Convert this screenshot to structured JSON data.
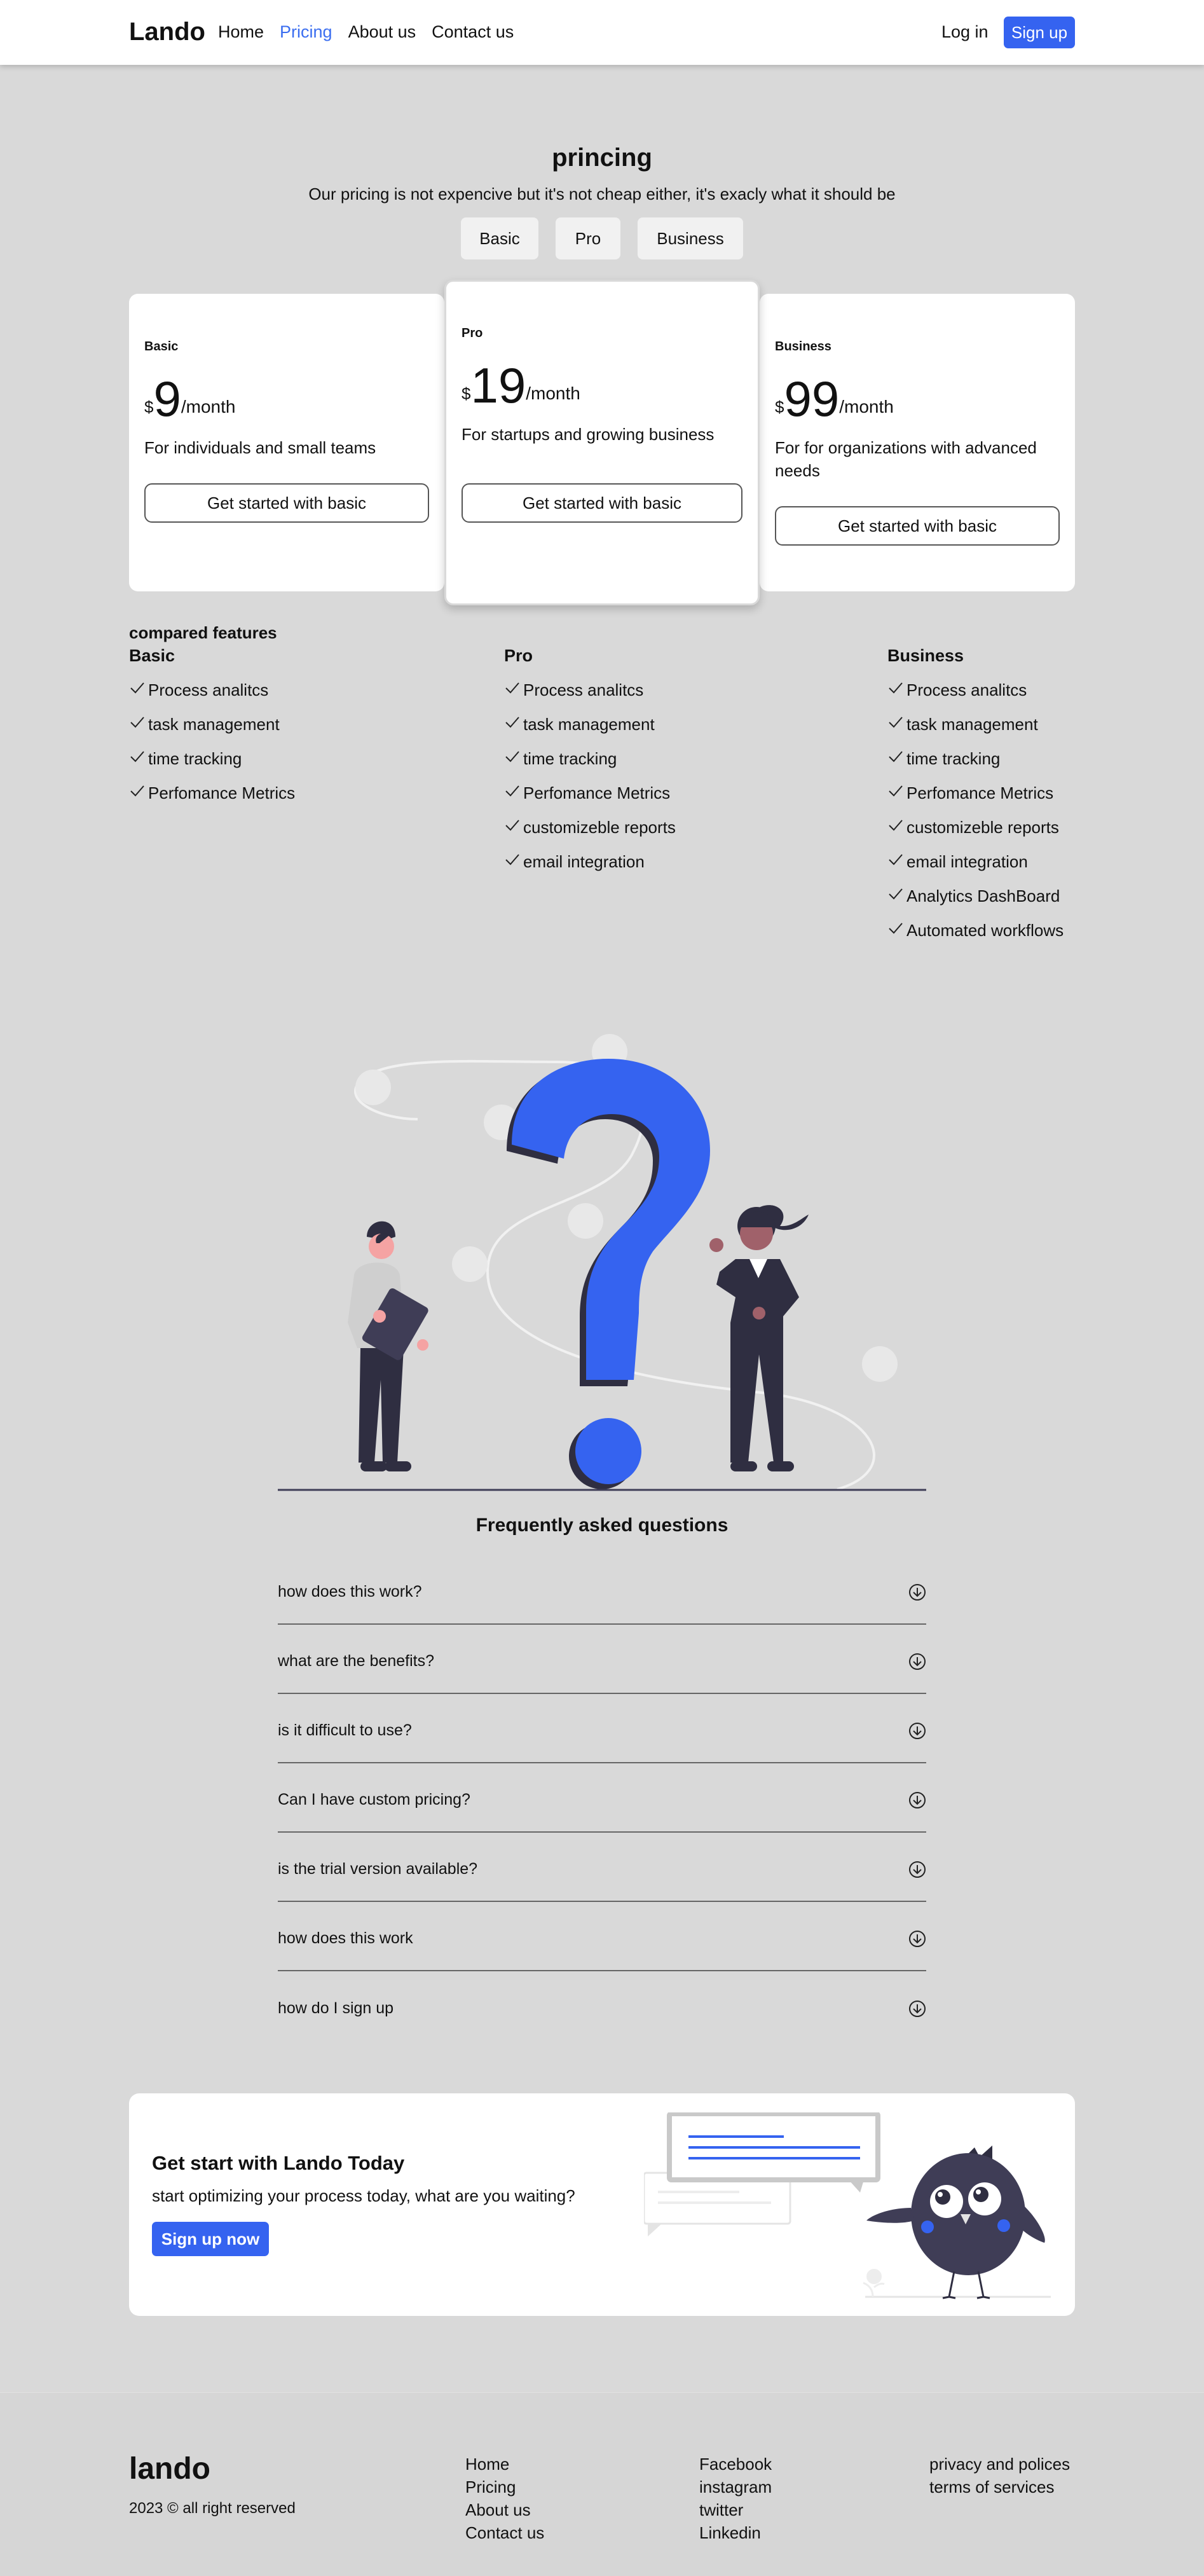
{
  "nav": {
    "logo": "Lando",
    "links": [
      "Home",
      "Pricing",
      "About us",
      "Contact us"
    ],
    "active_link": "Pricing",
    "login": "Log in",
    "signup": "Sign up"
  },
  "pricing": {
    "title": "princing",
    "subtitle": "Our pricing is not expencive but it's not cheap either, it's exacly what it should be",
    "tabs": [
      "Basic",
      "Pro",
      "Business"
    ]
  },
  "cards": [
    {
      "name": "Basic",
      "currency": "$",
      "amount": "9",
      "period": "/month",
      "description": "For individuals and small teams",
      "cta": "Get started with basic"
    },
    {
      "name": "Pro",
      "currency": "$",
      "amount": "19",
      "period": "/month",
      "description": "For startups and growing business",
      "cta": "Get started with basic"
    },
    {
      "name": "Business",
      "currency": "$",
      "amount": "99",
      "period": "/month",
      "description": "For for organizations with advanced needs",
      "cta": "Get started with basic"
    }
  ],
  "features": {
    "title": "compared features",
    "columns": [
      {
        "name": "Basic",
        "items": [
          "Process analitcs",
          "task management",
          "time tracking",
          "Perfomance Metrics"
        ]
      },
      {
        "name": "Pro",
        "items": [
          "Process analitcs",
          "task management",
          "time tracking",
          "Perfomance Metrics",
          "customizeble reports",
          "email integration"
        ]
      },
      {
        "name": "Business",
        "items": [
          "Process analitcs",
          "task management",
          "time tracking",
          "Perfomance Metrics",
          "customizeble reports",
          "email integration",
          "Analytics DashBoard",
          "Automated workflows"
        ]
      }
    ]
  },
  "faq": {
    "title": "Frequently asked questions",
    "items": [
      "how does this work?",
      "what are the benefits?",
      "is it difficult to use?",
      "Can I have custom pricing?",
      "is the trial version available?",
      "how does this work",
      "how do I sign up"
    ]
  },
  "banner": {
    "title": "Get start with Lando Today",
    "subtitle": "start optimizing your process today, what are you waiting?",
    "button": "Sign up now"
  },
  "footer": {
    "logo": "lando",
    "copyright": "2023 © all right reserved",
    "nav_links": [
      "Home",
      "Pricing",
      "About us",
      "Contact us"
    ],
    "social_links": [
      "Facebook",
      "instagram",
      "twitter",
      "Linkedin"
    ],
    "legal_links": [
      "privacy and polices",
      "terms of services"
    ]
  },
  "colors": {
    "accent": "#3563f0",
    "background": "#d9d9d9",
    "illustration_dark": "#2f2e41"
  }
}
